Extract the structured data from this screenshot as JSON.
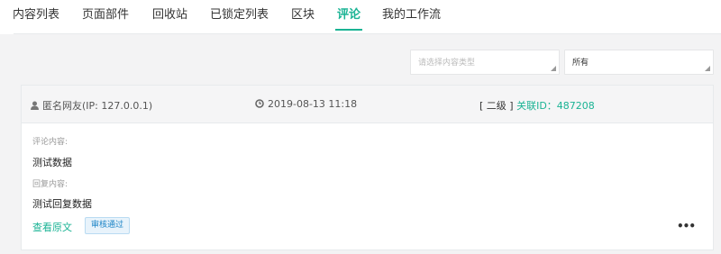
{
  "tabs": [
    {
      "label": "内容列表"
    },
    {
      "label": "页面部件"
    },
    {
      "label": "回收站"
    },
    {
      "label": "已锁定列表"
    },
    {
      "label": "区块"
    },
    {
      "label": "评论",
      "active": true
    },
    {
      "label": "我的工作流"
    }
  ],
  "filters": {
    "type_placeholder": "请选择内容类型",
    "status_value": "所有"
  },
  "comment": {
    "author": "匿名网友(IP:   127.0.0.1)",
    "time": "2019-08-13 11:18",
    "level": "[ 二级 ]",
    "relation_id": "关联ID：487208",
    "content_label": "评论内容:",
    "content": "测试数据",
    "reply_label": "回复内容:",
    "reply": "测试回复数据",
    "view_link": "查看原文",
    "status_badge": "审核通过",
    "more_icon": "•••"
  },
  "colors": {
    "accent": "#1ab394",
    "badge_text": "#1c84c6"
  },
  "icons": [
    "user-icon",
    "clock-icon",
    "more-icon"
  ]
}
